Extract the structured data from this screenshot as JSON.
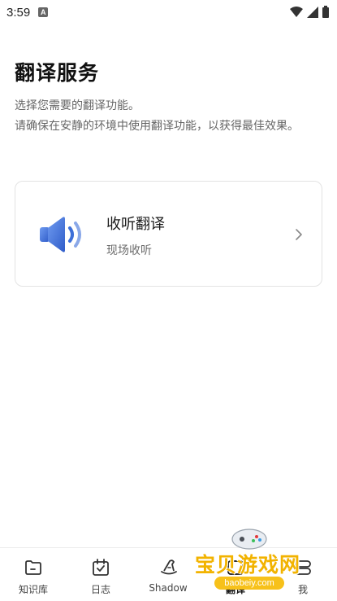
{
  "status_bar": {
    "time": "3:59",
    "notification": "A"
  },
  "page": {
    "title": "翻译服务",
    "description_line1": "选择您需要的翻译功能。",
    "description_line2": "请确保在安静的环境中使用翻译功能，以获得最佳效果。"
  },
  "card": {
    "title": "收听翻译",
    "subtitle": "现场收听",
    "icon": "speaker-icon"
  },
  "tabs": [
    {
      "label": "知识库",
      "icon": "folder-icon"
    },
    {
      "label": "日志",
      "icon": "calendar-check-icon"
    },
    {
      "label": "Shadow",
      "icon": "wizard-hat-icon"
    },
    {
      "label": "翻译",
      "icon": "translate-icon",
      "active": true
    },
    {
      "label": "我",
      "icon": "profile-icon"
    }
  ],
  "watermark": {
    "text": "宝贝游戏网",
    "url": "baobeiy.com"
  },
  "colors": {
    "speaker_blue": "#3d6fd8",
    "watermark_yellow": "#f2b300"
  }
}
